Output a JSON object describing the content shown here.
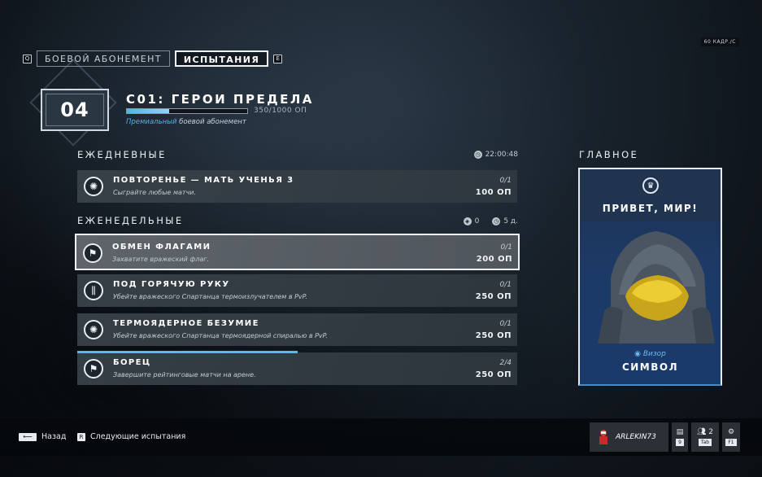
{
  "fps": "60 КАДР./С",
  "tabs": {
    "left_key": "Q",
    "right_key": "E",
    "items": [
      {
        "label": "БОЕВОЙ АБОНЕМЕНТ",
        "active": false
      },
      {
        "label": "ИСПЫТАНИЯ",
        "active": true
      }
    ]
  },
  "season": {
    "level": "04",
    "title": "С01: ГЕРОИ ПРЕДЕЛА",
    "progress": 0.35,
    "progress_text": "350/1000 ОП",
    "premium_highlight": "Премиальный",
    "premium_rest": " боевой абонемент"
  },
  "daily": {
    "title": "ЕЖЕДНЕВНЫЕ",
    "timer": "22:00:48",
    "items": [
      {
        "icon": "gear-icon",
        "name": "ПОВТОРЕНЬЕ — МАТЬ УЧЕНЬЯ 3",
        "desc": "Сыграйте любые матчи.",
        "count": "0/1",
        "points": "100 ОП"
      }
    ]
  },
  "weekly": {
    "title": "ЕЖЕНЕДЕЛЬНЫЕ",
    "rerolls": "0",
    "days": "5 д.",
    "items": [
      {
        "icon": "flag-icon",
        "name": "ОБМЕН ФЛАГАМИ",
        "desc": "Захватите вражеский флаг.",
        "count": "0/1",
        "points": "200 ОП",
        "selected": true
      },
      {
        "icon": "weapon-icon",
        "name": "ПОД ГОРЯЧУЮ РУКУ",
        "desc": "Убейте вражеского Спартанца термоизлучателем в PvP.",
        "count": "0/1",
        "points": "250 ОП"
      },
      {
        "icon": "gear-icon",
        "name": "ТЕРМОЯДЕРНОЕ БЕЗУМИЕ",
        "desc": "Убейте вражеского Спартанца термоядерной спиралью в PvP.",
        "count": "0/1",
        "points": "250 ОП"
      },
      {
        "icon": "flag-icon",
        "name": "БОРЕЦ",
        "desc": "Завершите рейтинговые матчи на арене.",
        "count": "2/4",
        "points": "250 ОП",
        "progress": 0.5
      }
    ]
  },
  "featured": {
    "title": "ГЛАВНОЕ",
    "name": "ПРИВЕТ, МИР!",
    "type": "Визор",
    "item": "СИМВОЛ"
  },
  "footer": {
    "back_label": "Назад",
    "next_key": "R",
    "next_label": "Следующие испытания",
    "player_name": "ARLEKIN73",
    "chat_key": "9",
    "friends_count": "2",
    "friends_key": "Tab",
    "settings_key": "F1"
  },
  "colors": {
    "accent": "#4fb4e8",
    "featured_bg": "#1d3a66"
  }
}
